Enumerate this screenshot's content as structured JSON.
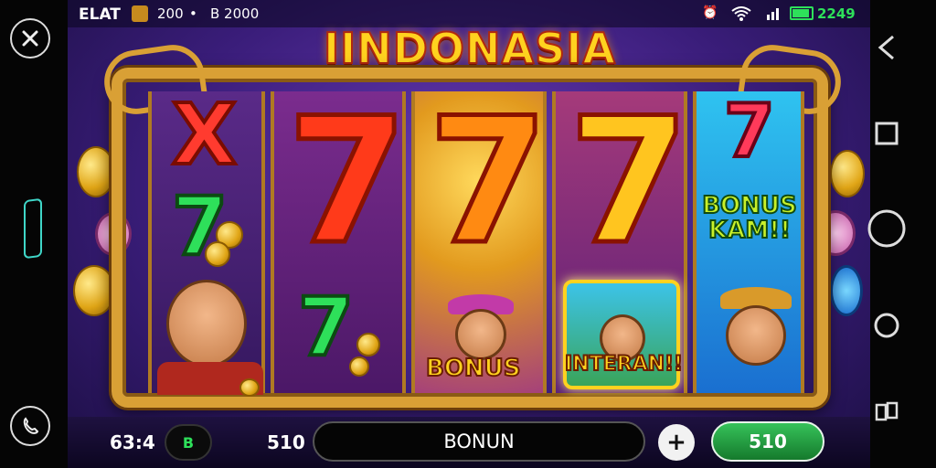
{
  "status_bar": {
    "left_label": "ELAT",
    "coins": "200",
    "dot": "•",
    "balance": "B 2000",
    "time": "2249"
  },
  "title": "IINDONASIA",
  "reels": {
    "reel1_top_symbol": "X",
    "reel1_mid_symbol": "7",
    "main_symbols": [
      "7",
      "7",
      "7"
    ],
    "reel2_bottom_symbol": "7",
    "reel3_bottom_label": "BONUS",
    "reel4_bottom_label": "INTERAN!!",
    "reel5_top_symbol": "7",
    "reel5_label_line1": "BONUS",
    "reel5_label_line2": "KAM!!"
  },
  "bottom_bar": {
    "left_value": "63:4",
    "left_pill": "B",
    "bet_value": "510",
    "center_button": "BONUN",
    "plus_button": "+",
    "spin_button": "510"
  },
  "icons": {
    "left_top": "close-icon",
    "left_bottom": "phone-icon",
    "nav_back": "back-icon",
    "nav_square": "square-icon",
    "nav_circle": "circle-icon",
    "nav_small_circle": "small-circle-icon",
    "nav_rotate": "rotate-icon"
  },
  "colors": {
    "title": "#ffd21f",
    "frame": "#d9a035",
    "spin_button": "#1e9a3a",
    "battery": "#2ee05a"
  }
}
